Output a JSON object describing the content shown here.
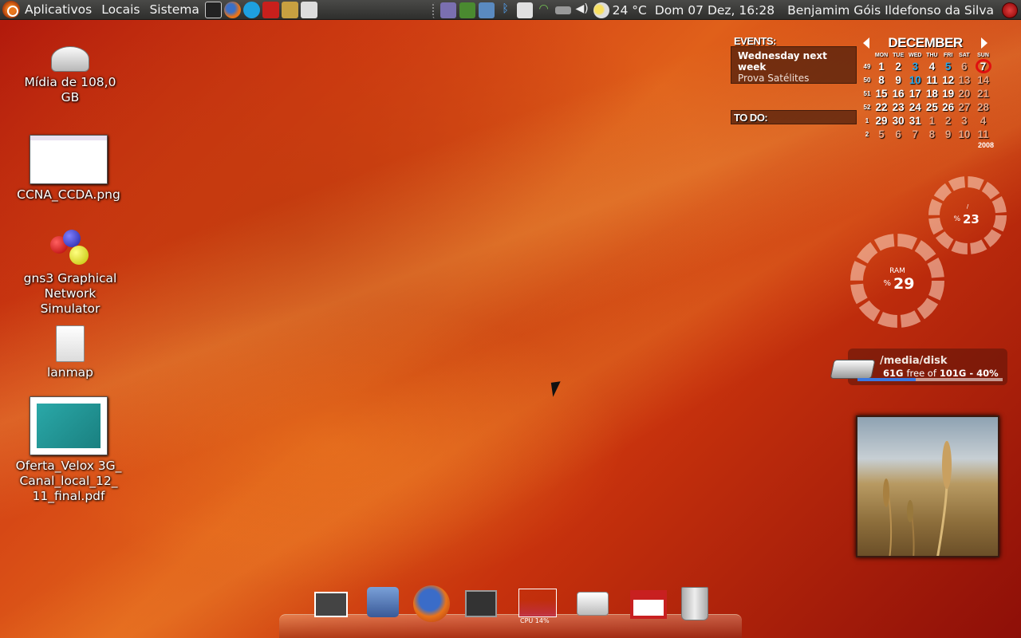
{
  "panel": {
    "menus": [
      "Aplicativos",
      "Locais",
      "Sistema"
    ],
    "temperature": "24 °C",
    "datetime": "Dom 07 Dez, 16:28",
    "username": "Benjamim Góis Ildefonso da Silva"
  },
  "desktop": {
    "icons": [
      {
        "label": "Mídia de 108,0 GB"
      },
      {
        "label": "CCNA_CCDA.png"
      },
      {
        "label": "gns3 Graphical Network Simulator"
      },
      {
        "label": "lanmap"
      },
      {
        "label": "Oferta_Velox 3G_ Canal_local_12_ 11_final.pdf"
      }
    ]
  },
  "events_widget": {
    "title": "EVENTS:",
    "event_title": "Wednesday next week",
    "event_desc": "Prova Satélites",
    "todo_title": "TO DO:"
  },
  "calendar": {
    "month": "DECEMBER",
    "year": "2008",
    "day_names": [
      "MON",
      "TUE",
      "WED",
      "THU",
      "FRI",
      "SAT",
      "SUN"
    ],
    "weeks": [
      {
        "wk": "49",
        "days": [
          "1",
          "2",
          "3",
          "4",
          "5",
          "6",
          "7"
        ]
      },
      {
        "wk": "50",
        "days": [
          "8",
          "9",
          "10",
          "11",
          "12",
          "13",
          "14"
        ]
      },
      {
        "wk": "51",
        "days": [
          "15",
          "16",
          "17",
          "18",
          "19",
          "20",
          "21"
        ]
      },
      {
        "wk": "52",
        "days": [
          "22",
          "23",
          "24",
          "25",
          "26",
          "27",
          "28"
        ]
      },
      {
        "wk": "1",
        "days": [
          "29",
          "30",
          "31",
          "1",
          "2",
          "3",
          "4"
        ]
      },
      {
        "wk": "2",
        "days": [
          "5",
          "6",
          "7",
          "8",
          "9",
          "10",
          "11"
        ]
      }
    ]
  },
  "gauges": {
    "cpu": {
      "symbol": "%",
      "value": "23",
      "top_label": "/"
    },
    "ram": {
      "label": "RAM",
      "symbol": "%",
      "value": "29"
    }
  },
  "disk_widget": {
    "path": "/media/disk",
    "free": "61G",
    "free_of": "free of",
    "total": "101G - 40%",
    "used_fraction": 0.4
  },
  "dock": {
    "cpu_label": "CPU 14%"
  },
  "colors": {
    "accent_blue": "#2aa7e8",
    "today_ring": "#e01010"
  }
}
